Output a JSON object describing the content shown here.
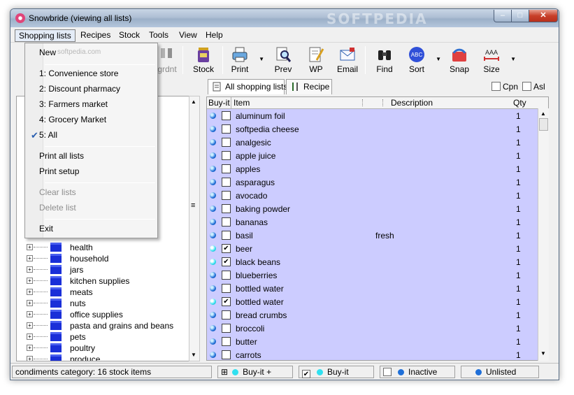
{
  "window": {
    "title": "Snowbride (viewing all lists)",
    "watermark": "SOFTPEDIA",
    "min_glyph": "–",
    "max_glyph": "□",
    "close_glyph": "✕"
  },
  "menubar": [
    "Shopping lists",
    "Recipes",
    "Stock",
    "Tools",
    "View",
    "Help"
  ],
  "toolbar": [
    {
      "label": "grdnt",
      "icon": "gradient-icon",
      "disabled": true
    },
    {
      "label": "Stock",
      "icon": "stock-jar-icon"
    },
    {
      "label": "Print",
      "icon": "printer-icon",
      "dropdown": true
    },
    {
      "label": "Prev",
      "icon": "preview-magnifier-icon"
    },
    {
      "label": "WP",
      "icon": "word-processor-icon"
    },
    {
      "label": "Email",
      "icon": "email-icon"
    },
    {
      "label": "Find",
      "icon": "binoculars-icon"
    },
    {
      "label": "Sort",
      "icon": "sort-abc-icon",
      "dropdown": true
    },
    {
      "label": "Snap",
      "icon": "snap-icon"
    },
    {
      "label": "Size",
      "icon": "size-icon",
      "dropdown": true
    }
  ],
  "tabs": [
    {
      "label": "All shopping lists",
      "icon": "list-icon"
    },
    {
      "label": "Recipe",
      "icon": "cutlery-icon"
    }
  ],
  "options": {
    "cpn": "Cpn",
    "asl": "Asl"
  },
  "dropdown_menu": {
    "new": "New",
    "new_watermark": "softpedia.com",
    "lists": [
      "1: Convenience store",
      "2: Discount pharmacy",
      "3: Farmers market",
      "4: Grocery Market",
      "5: All"
    ],
    "checked": "✔",
    "print_all": "Print all lists",
    "print_setup": "Print setup",
    "clear": "Clear lists",
    "delete": "Delete list",
    "exit": "Exit"
  },
  "tree": {
    "expander": "+",
    "items": [
      "health",
      "household",
      "jars",
      "kitchen supplies",
      "meats",
      "nuts",
      "office supplies",
      "pasta and grains and beans",
      "pets",
      "poultry",
      "produce"
    ]
  },
  "grid": {
    "headers": {
      "buyit": "Buy-it",
      "item": "Item",
      "description": "Description",
      "qty": "Qty"
    },
    "rows": [
      {
        "item": "aluminum foil",
        "desc": "",
        "qty": "1",
        "checked": false,
        "dot": "blue"
      },
      {
        "item": "softpedia cheese",
        "desc": "",
        "qty": "1",
        "checked": false,
        "dot": "blue"
      },
      {
        "item": "analgesic",
        "desc": "",
        "qty": "1",
        "checked": false,
        "dot": "blue"
      },
      {
        "item": "apple juice",
        "desc": "",
        "qty": "1",
        "checked": false,
        "dot": "blue"
      },
      {
        "item": "apples",
        "desc": "",
        "qty": "1",
        "checked": false,
        "dot": "blue"
      },
      {
        "item": "asparagus",
        "desc": "",
        "qty": "1",
        "checked": false,
        "dot": "blue"
      },
      {
        "item": "avocado",
        "desc": "",
        "qty": "1",
        "checked": false,
        "dot": "blue"
      },
      {
        "item": "baking powder",
        "desc": "",
        "qty": "1",
        "checked": false,
        "dot": "blue"
      },
      {
        "item": "bananas",
        "desc": "",
        "qty": "1",
        "checked": false,
        "dot": "blue"
      },
      {
        "item": "basil",
        "desc": "fresh",
        "qty": "1",
        "checked": false,
        "dot": "blue"
      },
      {
        "item": "beer",
        "desc": "",
        "qty": "1",
        "checked": true,
        "dot": "cyan"
      },
      {
        "item": "black beans",
        "desc": "",
        "qty": "1",
        "checked": true,
        "dot": "cyan"
      },
      {
        "item": "blueberries",
        "desc": "",
        "qty": "1",
        "checked": false,
        "dot": "blue"
      },
      {
        "item": "bottled water",
        "desc": "",
        "qty": "1",
        "checked": false,
        "dot": "blue"
      },
      {
        "item": "bottled water",
        "desc": "",
        "qty": "1",
        "checked": true,
        "dot": "cyan"
      },
      {
        "item": "bread crumbs",
        "desc": "",
        "qty": "1",
        "checked": false,
        "dot": "blue"
      },
      {
        "item": "broccoli",
        "desc": "",
        "qty": "1",
        "checked": false,
        "dot": "blue"
      },
      {
        "item": "butter",
        "desc": "",
        "qty": "1",
        "checked": false,
        "dot": "blue"
      },
      {
        "item": "carrots",
        "desc": "",
        "qty": "1",
        "checked": false,
        "dot": "blue"
      }
    ],
    "check_glyph": "✔"
  },
  "scroll": {
    "up": "▲",
    "down": "▼",
    "grip": "≡"
  },
  "statusbar": {
    "category": "condiments category:  16 stock items",
    "legend": [
      {
        "label": "Buy-it +",
        "box": "⊞",
        "dot": "#30e0f0"
      },
      {
        "label": "Buy-it",
        "box": "✔",
        "dot": "#30e0f0"
      },
      {
        "label": "Inactive",
        "box": "",
        "dot": "#1f6fd8"
      },
      {
        "label": "Unlisted",
        "box": "",
        "dot": "#1f6fd8"
      }
    ]
  },
  "colors": {
    "grid_bg": "#ccccff",
    "folder": "#1a2fd8",
    "accent": "#2a5fb0"
  }
}
